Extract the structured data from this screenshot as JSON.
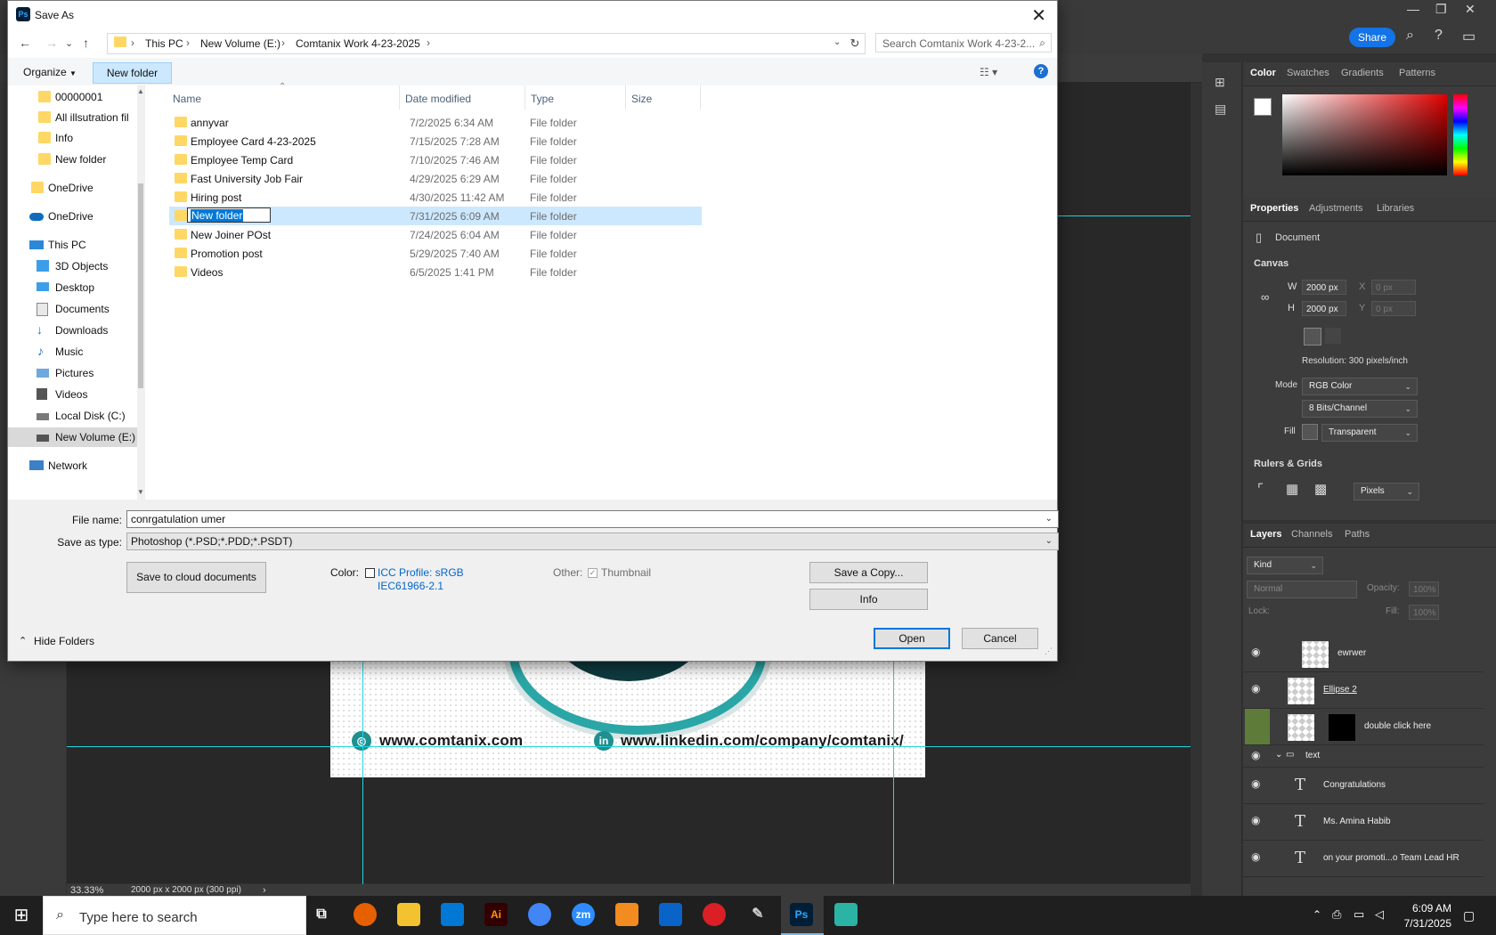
{
  "dialog": {
    "title": "Save As",
    "breadcrumb": [
      "This PC",
      "New Volume (E:)",
      "Comtanix Work 4-23-2025"
    ],
    "search_placeholder": "Search Comtanix Work 4-23-2...",
    "organize_label": "Organize",
    "new_folder_label": "New folder",
    "columns": {
      "name": "Name",
      "date": "Date modified",
      "type": "Type",
      "size": "Size"
    },
    "files": [
      {
        "name": "annyvar",
        "date": "7/2/2025 6:34 AM",
        "type": "File folder"
      },
      {
        "name": "Employee Card 4-23-2025",
        "date": "7/15/2025 7:28 AM",
        "type": "File folder"
      },
      {
        "name": "Employee Temp Card",
        "date": "7/10/2025 7:46 AM",
        "type": "File folder"
      },
      {
        "name": "Fast University Job Fair",
        "date": "4/29/2025 6:29 AM",
        "type": "File folder"
      },
      {
        "name": "Hiring post",
        "date": "4/30/2025 11:42 AM",
        "type": "File folder"
      },
      {
        "name": "New folder",
        "date": "7/31/2025 6:09 AM",
        "type": "File folder",
        "renaming": true
      },
      {
        "name": "New Joiner POst",
        "date": "7/24/2025 6:04 AM",
        "type": "File folder"
      },
      {
        "name": "Promotion post",
        "date": "5/29/2025 7:40 AM",
        "type": "File folder"
      },
      {
        "name": "Videos",
        "date": "6/5/2025 1:41 PM",
        "type": "File folder"
      }
    ],
    "nav_items": [
      {
        "label": "00000001",
        "icon": "folder-icon"
      },
      {
        "label": "All illsutration fil",
        "icon": "folder-icon"
      },
      {
        "label": "Info",
        "icon": "folder-icon"
      },
      {
        "label": "New folder",
        "icon": "folder-icon"
      },
      {
        "label": "OneDrive",
        "icon": "folder-icon"
      },
      {
        "label": "OneDrive",
        "icon": "cloud-icon"
      },
      {
        "label": "This PC",
        "icon": "computer-icon"
      },
      {
        "label": "3D Objects",
        "icon": "cube-icon"
      },
      {
        "label": "Desktop",
        "icon": "desktop-icon"
      },
      {
        "label": "Documents",
        "icon": "documents-icon"
      },
      {
        "label": "Downloads",
        "icon": "download-icon"
      },
      {
        "label": "Music",
        "icon": "music-icon"
      },
      {
        "label": "Pictures",
        "icon": "pictures-icon"
      },
      {
        "label": "Videos",
        "icon": "videos-icon"
      },
      {
        "label": "Local Disk (C:)",
        "icon": "disk-icon"
      },
      {
        "label": "New Volume (E:)",
        "icon": "drive-icon",
        "selected": true
      },
      {
        "label": "Network",
        "icon": "network-icon"
      }
    ],
    "file_name_label": "File name:",
    "file_name_value": "conrgatulation umer",
    "save_type_label": "Save as type:",
    "save_type_value": "Photoshop (*.PSD;*.PDD;*.PSDT)",
    "cloud_button": "Save to cloud documents",
    "color_label": "Color:",
    "icc_line1": "ICC Profile:  sRGB",
    "icc_line2": "IEC61966-2.1",
    "other_label": "Other:",
    "thumbnail_label": "Thumbnail",
    "save_copy_button": "Save a Copy...",
    "info_button": "Info",
    "hide_folders": "Hide Folders",
    "open_button": "Open",
    "cancel_button": "Cancel"
  },
  "photoshop": {
    "share_label": "Share",
    "zoom": "33.33%",
    "doc_info": "2000 px x 2000 px (300 ppi)",
    "doc_web": "www.comtanix.com",
    "doc_linkedin": "www.linkedin.com/company/comtanix/",
    "color_tabs": [
      "Color",
      "Swatches",
      "Gradients",
      "Patterns"
    ],
    "props_tabs": [
      "Properties",
      "Adjustments",
      "Libraries"
    ],
    "props": {
      "document": "Document",
      "canvas": "Canvas",
      "w_label": "W",
      "w_value": "2000 px",
      "h_label": "H",
      "h_value": "2000 px",
      "x_label": "X",
      "x_value": "0 px",
      "y_label": "Y",
      "y_value": "0 px",
      "resolution": "Resolution: 300 pixels/inch",
      "mode_label": "Mode",
      "mode_value": "RGB Color",
      "bits_value": "8 Bits/Channel",
      "fill_label": "Fill",
      "fill_value": "Transparent",
      "rulers": "Rulers & Grids",
      "units": "Pixels"
    },
    "layers_tabs": [
      "Layers",
      "Channels",
      "Paths"
    ],
    "layers_filter": "Kind",
    "blend_mode": "Normal",
    "opacity_label": "Opacity:",
    "opacity_value": "100%",
    "lock_label": "Lock:",
    "fill_label": "Fill:",
    "fill_value": "100%",
    "layers": [
      "ewrwer",
      "Ellipse 2",
      "double click here",
      "text",
      "Congratulations",
      "Ms. Amina Habib",
      "on your promoti...o Team Lead HR"
    ]
  },
  "taskbar": {
    "search_placeholder": "Type here to search",
    "time": "6:09 AM",
    "date": "7/31/2025",
    "apps": [
      "Ai",
      "zm",
      "Ps"
    ]
  }
}
